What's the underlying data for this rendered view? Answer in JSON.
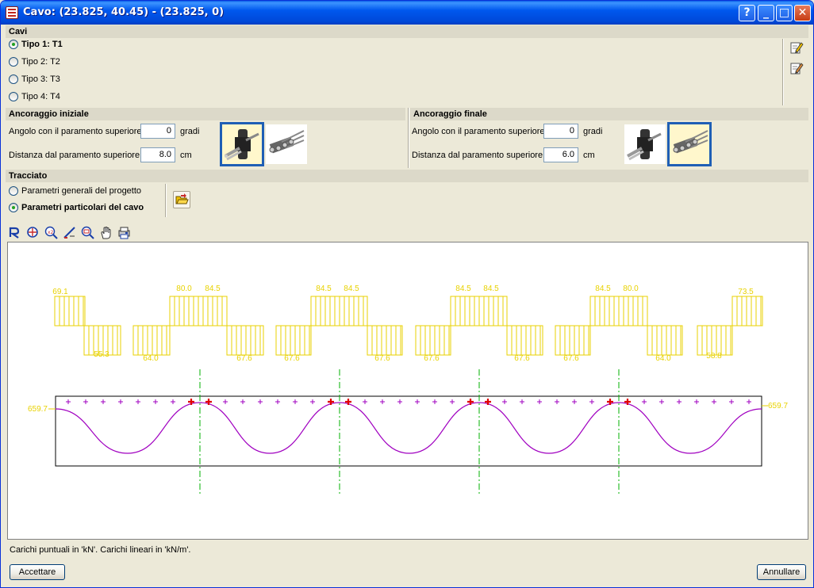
{
  "window": {
    "title": "Cavo: (23.825, 40.45) - (23.825, 0)",
    "help_label": "?",
    "minimize_label": "_",
    "maximize_label": "□",
    "close_label": "✕"
  },
  "cavi": {
    "header": "Cavi",
    "options": [
      {
        "label": "Tipo 1: T1",
        "selected": true
      },
      {
        "label": "Tipo 2: T2",
        "selected": false
      },
      {
        "label": "Tipo 3: T3",
        "selected": false
      },
      {
        "label": "Tipo 4: T4",
        "selected": false
      }
    ],
    "icons": [
      "edit-icon",
      "edit-copy-icon"
    ]
  },
  "ancoraggio_iniziale": {
    "header": "Ancoraggio iniziale",
    "angle_label": "Angolo con il paramento superiore",
    "angle_value": "0",
    "angle_unit": "gradi",
    "dist_label": "Distanza dal paramento superiore",
    "dist_value": "8.0",
    "dist_unit": "cm",
    "selected_anchor": "active"
  },
  "ancoraggio_finale": {
    "header": "Ancoraggio finale",
    "angle_label": "Angolo con il paramento superiore",
    "angle_value": "0",
    "angle_unit": "gradi",
    "dist_label": "Distanza dal paramento superiore",
    "dist_value": "6.0",
    "dist_unit": "cm",
    "selected_anchor": "passive"
  },
  "tracciato": {
    "header": "Tracciato",
    "options": [
      {
        "label": "Parametri generali del progetto",
        "selected": false
      },
      {
        "label": "Parametri particolari del cavo",
        "selected": true
      }
    ]
  },
  "toolbar": {
    "icons": [
      "redraw-icon",
      "zoom-all-icon",
      "zoom-x2-icon",
      "measure-icon",
      "zoom-window-icon",
      "pan-hand-icon",
      "print-icon"
    ]
  },
  "drawing": {
    "end_label_left": "659.7",
    "end_label_right": "659.7",
    "load_labels_top": [
      "69.1",
      "80.0",
      "84.5",
      "84.5",
      "84.5",
      "84.5",
      "84.5",
      "84.5",
      "80.0",
      "73.5"
    ],
    "load_labels_bottom": [
      "55.3",
      "64.0",
      "67.6",
      "67.6",
      "67.6",
      "67.6",
      "67.6",
      "67.6",
      "64.0",
      "58.8"
    ],
    "colors": {
      "loads": "#E8D200",
      "labels": "#E8D200",
      "cable": "#A000C0",
      "axis": "#00B000",
      "support_marks": "#E00000",
      "tick_marks": "#A000C0"
    }
  },
  "status_text": "Carichi puntuali in 'kN'. Carichi lineari in 'kN/m'.",
  "buttons": {
    "accept_label": "Accettare",
    "cancel_label": "Annullare"
  }
}
